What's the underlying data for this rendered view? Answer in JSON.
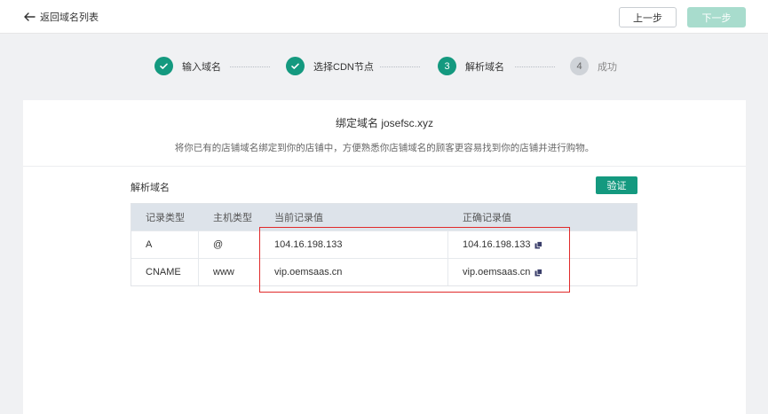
{
  "header": {
    "back_label": "返回域名列表",
    "prev_label": "上一步",
    "next_label": "下一步"
  },
  "steps": [
    {
      "number": "1",
      "label": "输入域名",
      "status": "done"
    },
    {
      "number": "2",
      "label": "选择CDN节点",
      "status": "done"
    },
    {
      "number": "3",
      "label": "解析域名",
      "status": "active"
    },
    {
      "number": "4",
      "label": "成功",
      "status": "todo"
    }
  ],
  "card": {
    "title": "绑定域名 josefsc.xyz",
    "subtitle": "将你已有的店铺域名绑定到你的店铺中，方便熟悉你店铺域名的顾客更容易找到你的店铺并进行购物。",
    "section_label": "解析域名",
    "verify_label": "验证"
  },
  "table": {
    "headers": [
      "记录类型",
      "主机类型",
      "当前记录值",
      "正确记录值"
    ],
    "rows": [
      {
        "type": "A",
        "host": "@",
        "current": "104.16.198.133",
        "correct": "104.16.198.133"
      },
      {
        "type": "CNAME",
        "host": "www",
        "current": "vip.oemsaas.cn",
        "correct": "vip.oemsaas.cn"
      }
    ]
  },
  "colors": {
    "accent": "#14997f",
    "next_disabled": "#a8dccd",
    "highlight": "#e02a2a"
  }
}
